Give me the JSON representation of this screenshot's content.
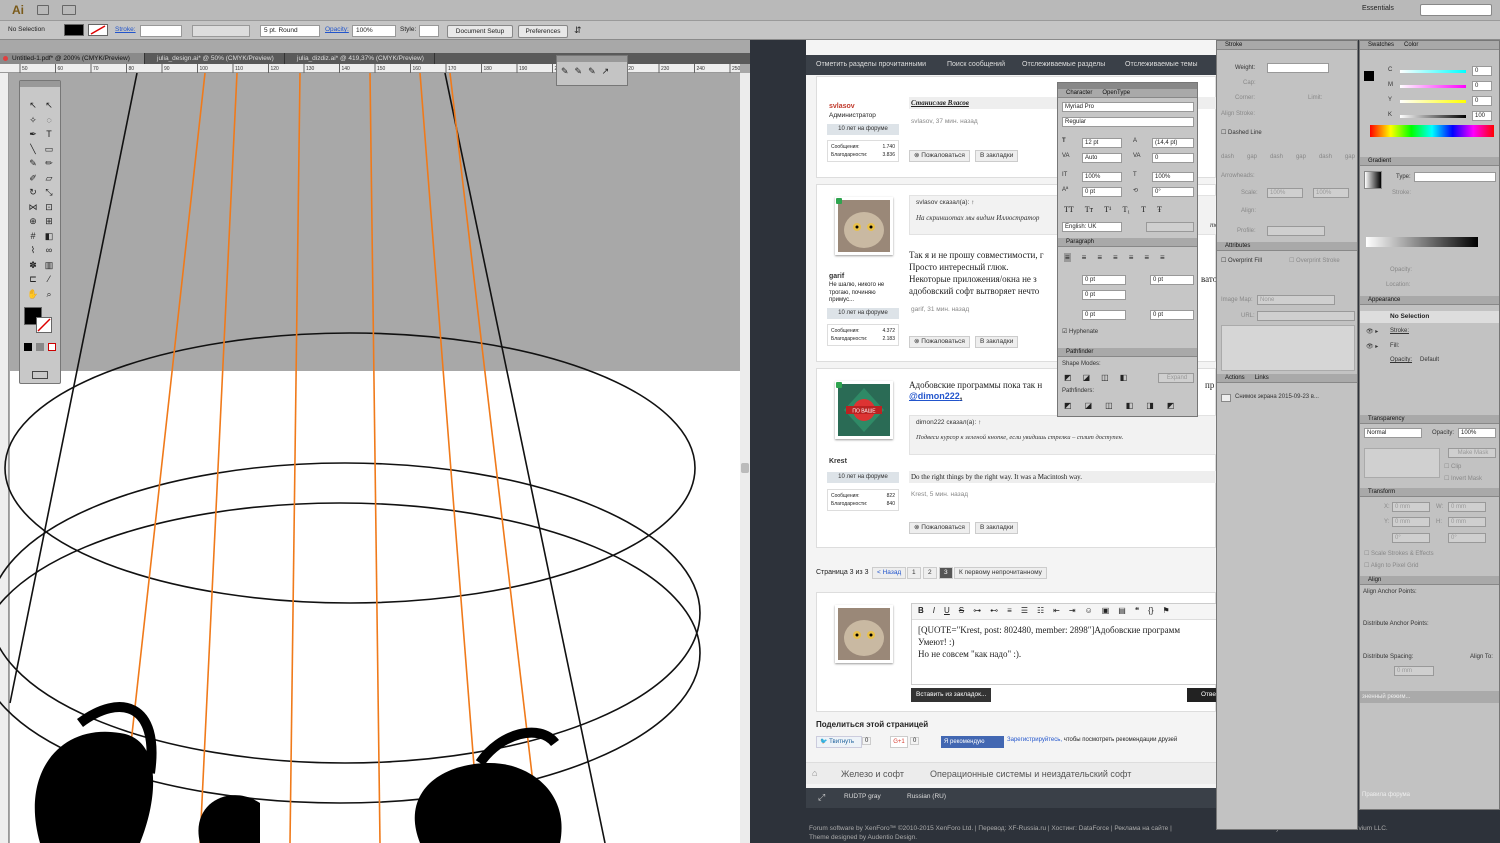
{
  "app": {
    "logo": "Ai",
    "workspace": "Essentials"
  },
  "control_bar": {
    "selection": "No Selection",
    "stroke_label": "Stroke:",
    "brush": "5 pt. Round",
    "opacity_label": "Opacity:",
    "opacity_value": "100%",
    "style_label": "Style:",
    "doc_setup": "Document Setup",
    "preferences": "Preferences"
  },
  "doc_tabs": [
    "Untitled-1.pdf* @ 200% (CMYK/Preview)",
    "julia_design.ai* @ 50% (CMYK/Preview)",
    "julia_dizdiz.ai* @ 419,37% (CMYK/Preview)"
  ],
  "ruler_marks": [
    "50",
    "60",
    "70",
    "80",
    "90",
    "100",
    "110",
    "120",
    "130",
    "140",
    "150",
    "160",
    "170",
    "180",
    "190",
    "200",
    "210",
    "220",
    "230",
    "240",
    "250"
  ],
  "forum": {
    "nav": [
      "Отметить разделы прочитанными",
      "Поиск сообщений",
      "Отслеживаемые разделы",
      "Отслеживаемые темы"
    ],
    "posts": [
      {
        "user": "svlasov",
        "role": "Администратор",
        "badge": "10 лет на форуме",
        "stats": [
          [
            "Сообщения:",
            "1.740"
          ],
          [
            "Благодарности:",
            "3.836"
          ]
        ],
        "quote_author": "Станислав Власов",
        "meta": "svlasov, 37 мин. назад",
        "report": "Пожаловаться",
        "bookmark": "В закладки"
      },
      {
        "user": "garif",
        "role": "Не шалю, никого не трогаю, починяю примус...",
        "badge": "10 лет на форуме",
        "stats": [
          [
            "Сообщения:",
            "4.372"
          ],
          [
            "Благодарности:",
            "2.183"
          ]
        ],
        "quote_head": "svlasov сказал(а): ↑",
        "quote_text": "На скриншотах мы видим Иллюстратор",
        "quote_tail": "тор",
        "text": [
          "Так я и не прошу совместимости, г",
          "Просто интересный глюк.",
          "Некоторые приложения/окна не з",
          "адобовский софт вытворяет нечто"
        ],
        "text_tail": "ватор",
        "meta": "garif, 31 мин. назад",
        "report": "Пожаловаться",
        "bookmark": "В закладки"
      },
      {
        "user": "Krest",
        "badge": "10 лет на форуме",
        "stats": [
          [
            "Сообщения:",
            "822"
          ],
          [
            "Благодарности:",
            "840"
          ]
        ],
        "badge_ribbon": "ПО ВАШЕ",
        "text": "Адобовские программы пока так н",
        "text_tail": "пр",
        "mention": "@dimon222",
        "quote_head": "dimon222 сказал(а): ↑",
        "quote_text": "Подвеси курсор к зеленой кнопке, если увидишь стрелки – сплит доступен.",
        "signature": "Do the right things by the right way. It was a Macintosh way.",
        "meta": "Krest, 5 мин. назад",
        "report": "Пожаловаться",
        "bookmark": "В закладки"
      }
    ],
    "pagination": {
      "label": "Страница 3 из 3",
      "prev": "< Назад",
      "pages": [
        "1",
        "2",
        "3"
      ],
      "first_unread": "К первому непрочитанному"
    },
    "editor": {
      "lines": [
        "[QUOTE=\"Krest, post: 802480, member: 2898\"]Адобовские программ",
        "Умеют! :)",
        "Но не совсем \"как надо\" :)."
      ],
      "insert_bookmarks": "Вставить из закладок...",
      "reply": "Отве"
    },
    "share": {
      "title": "Поделиться этой страницей",
      "tweet": "Твитнуть",
      "tweet_count": "0",
      "gplus": "G+1",
      "gplus_count": "0",
      "fb": "Я рекомендую",
      "fb_link": "Зарегистрируйтесь,",
      "fb_text": "чтобы посмотреть рекомендации друзей"
    },
    "breadcrumb": [
      "Железо и софт",
      "Операционные системы и неиздательский софт"
    ],
    "footer_bar": [
      "RUDTP gray",
      "Russian (RU)"
    ],
    "footer_lines": [
      "Forum software by XenForo™ ©2010-2015 XenForo Ltd. | Перевод: XF-Russia.ru | Хостинг: DataForce | Реклама на сайте |",
      "Theme designed by Audentio Design."
    ],
    "footer_right": "XenForo Add-ons by Brivium™ © 2012-2015 Brivium LLC."
  },
  "character": {
    "tabs": [
      "Character",
      "OpenType"
    ],
    "font": "Myriad Pro",
    "style": "Regular",
    "size": "12 pt",
    "leading": "(14,4 pt)",
    "kerning": "Auto",
    "tracking": "0",
    "vscale": "100%",
    "hscale": "100%",
    "baseline": "0 pt",
    "rotation": "0°",
    "language": "English: UK"
  },
  "paragraph": {
    "title": "Paragraph",
    "fields": [
      "0 pt",
      "0 pt",
      "0 pt",
      "0 pt",
      "0 pt"
    ],
    "hyphenate": "Hyphenate"
  },
  "pathfinder": {
    "title": "Pathfinder",
    "shape_modes": "Shape Modes:",
    "expand": "Expand",
    "pathfinders": "Pathfinders:"
  },
  "stroke": {
    "title": "Stroke",
    "weight": "Weight:",
    "cap": "Cap:",
    "corner": "Corner:",
    "limit": "Limit:",
    "align": "Align Stroke:",
    "dashed": "Dashed Line",
    "dash_labels": [
      "dash",
      "gap",
      "dash",
      "gap",
      "dash",
      "gap"
    ],
    "arrowheads": "Arrowheads:",
    "scale": "Scale:",
    "scale_vals": [
      "100%",
      "100%"
    ],
    "align2": "Align:",
    "profile": "Profile:"
  },
  "attributes": {
    "title": "Attributes",
    "overprint_fill": "Overprint Fill",
    "overprint_stroke": "Overprint Stroke",
    "image_map": "Image Map:",
    "image_map_val": "None",
    "url": "URL:"
  },
  "actions": {
    "tabs": [
      "Actions",
      "Links"
    ],
    "link_item": "Снимок экрана 2015-09-23 в..."
  },
  "swatches": {
    "tabs": [
      "Swatches",
      "Color"
    ],
    "channels": [
      [
        "C",
        "0"
      ],
      [
        "M",
        "0"
      ],
      [
        "Y",
        "0"
      ],
      [
        "K",
        "100"
      ]
    ]
  },
  "gradient": {
    "title": "Gradient",
    "type": "Type:",
    "stroke": "Stroke:",
    "opacity": "Opacity:",
    "location": "Location:"
  },
  "appearance": {
    "title": "Appearance",
    "no_selection": "No Selection",
    "stroke": "Stroke:",
    "fill": "Fill:",
    "opacity": "Opacity:",
    "opacity_val": "Default"
  },
  "transparency": {
    "title": "Transparency",
    "mode": "Normal",
    "opacity": "Opacity:",
    "opacity_val": "100%",
    "make_mask": "Make Mask",
    "clip": "Clip",
    "invert": "Invert Mask"
  },
  "transform": {
    "title": "Transform",
    "x": "X:",
    "y": "Y:",
    "w": "W:",
    "h": "H:",
    "x_val": "0 mm",
    "y_val": "0 mm",
    "w_val": "0 mm",
    "h_val": "0 mm",
    "angle": "0°",
    "shear": "0°",
    "scale_strokes": "Scale Strokes & Effects",
    "pixel_grid": "Align to Pixel Grid"
  },
  "align": {
    "title": "Align",
    "anchor": "Align Anchor Points:",
    "distribute": "Distribute Anchor Points:",
    "spacing": "Distribute Spacing:",
    "align_to": "Align To:",
    "spacing_val": "0 mm"
  },
  "ghost": {
    "top": "Правила форума",
    "bottom": "зненный режим..."
  },
  "colors": {
    "accent_orange": "#f07a1a",
    "forum_red": "#c0392b",
    "link_blue": "#2255cc"
  }
}
